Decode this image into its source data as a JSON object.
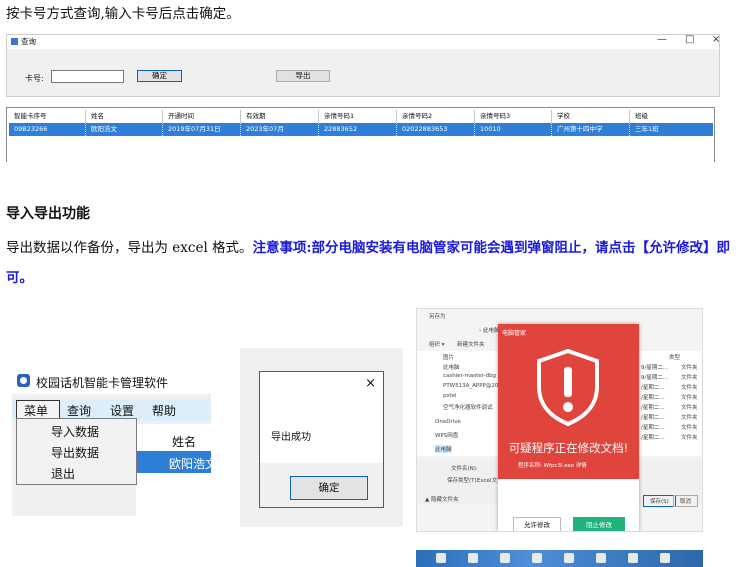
{
  "intro_line": "按卡号方式查询,输入卡号后点击确定。",
  "query_window": {
    "title": "查询",
    "controls": [
      "—",
      "□",
      "×"
    ],
    "card_label": "卡号:",
    "card_input_value": "",
    "confirm_label": "确定",
    "export_label": "导出"
  },
  "grid": {
    "headers": [
      "智能卡序号",
      "姓名",
      "开通时间",
      "有效期",
      "亲情号码1",
      "亲情号码2",
      "亲情号码3",
      "学校",
      "班级"
    ],
    "row": [
      "09B23266",
      "欧阳浩文",
      "2019年07月31日",
      "2023年07月",
      "22883652",
      "02022883653",
      "10010",
      "广州第十四中学",
      "三年1班"
    ]
  },
  "section_title": "导入导出功能",
  "paragraph": {
    "plain": "导出数据以作备份，导出为 excel 格式。",
    "notice": "注意事项:部分电脑安装有电脑管家可能会遇到弹窗阻止，请点击【允许修改】即可。"
  },
  "menu_screenshot": {
    "app_title": "校园话机智能卡管理软件",
    "menus": [
      "菜单",
      "查询",
      "设置",
      "帮助"
    ],
    "dropdown": [
      "导入数据",
      "导出数据",
      "退出"
    ],
    "grid_header": "姓名",
    "grid_value": "欧阳浩文"
  },
  "export_dialog": {
    "close": "×",
    "message": "导出成功",
    "ok_label": "确定"
  },
  "security_screenshot": {
    "window_title": "另存为",
    "nav_path": "› 此电脑 ›",
    "toolbar": [
      "组织 ▾",
      "新建文件夹"
    ],
    "sidebar": [
      "图片",
      "此电脑",
      "cashier-master-dbg",
      "PTW513A_APPP@2019",
      "pstel",
      "空气净化器软件调试",
      "OneDrive",
      "WPS网盘",
      "此电脑"
    ],
    "list_header": "类型",
    "list_items": [
      "文件夹",
      "文件夹",
      "文件夹",
      "文件夹",
      "文件夹",
      "文件夹",
      "文件夹",
      "文件夹"
    ],
    "list_dates": [
      "9/星期二...",
      "9/星期二...",
      "/星期二...",
      "/星期二...",
      "/星期二...",
      "/星期二...",
      "/星期二...",
      "/星期二..."
    ],
    "file_name_label": "文件名(N):",
    "file_type_label": "保存类型(T):",
    "file_type_value": "Excel文件",
    "hide_folders": "▲ 隐藏文件夹",
    "save_button": "保存(S)",
    "cancel_button": "取消",
    "popup_header": "电脑管家",
    "popup_message": "可疑程序正在修改文档!",
    "popup_program": "程序名称: Wfpc3l.exe 详情",
    "allow_button": "允许修改",
    "block_button": "阻止修改",
    "colors": {
      "popup_red": "#e0453d",
      "block_green": "#1fb37c"
    }
  }
}
